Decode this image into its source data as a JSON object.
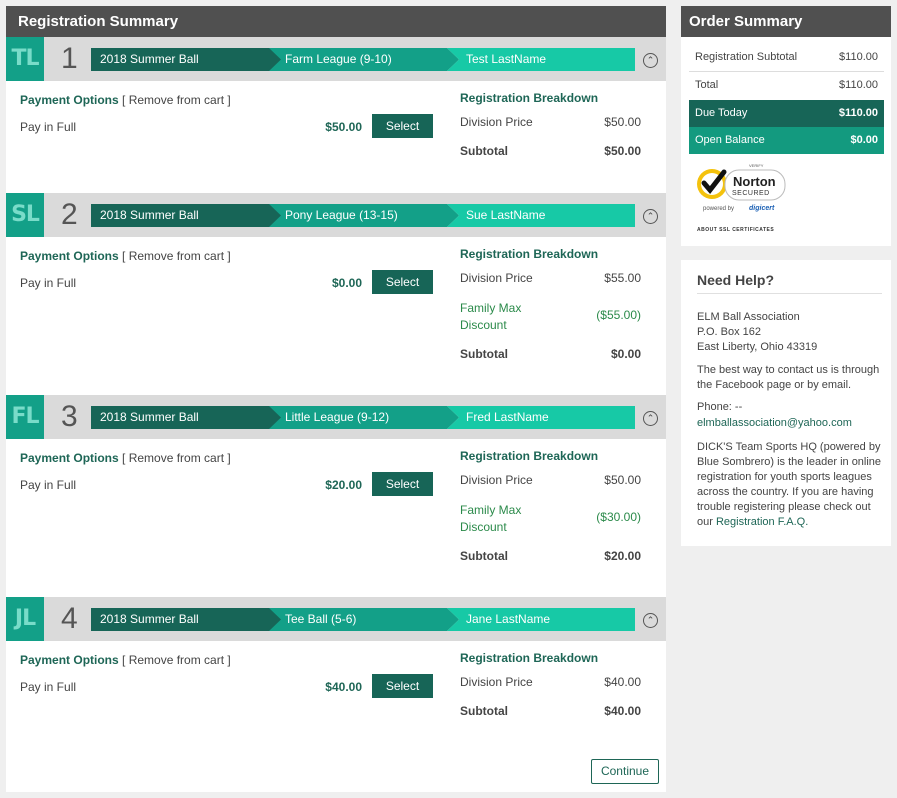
{
  "main": {
    "title": "Registration Summary",
    "continue_label": "Continue",
    "payment_options_label": "Payment Options",
    "remove_label": "[ Remove from cart ]",
    "pay_in_full_label": "Pay in Full",
    "select_label": "Select",
    "breakdown_title": "Registration Breakdown",
    "registrations": [
      {
        "initials": "TL",
        "number": "1",
        "season": "2018 Summer Ball",
        "league": "Farm League (9-10)",
        "player": "Test LastName",
        "price": "$50.00",
        "breakdown": [
          {
            "label": "Division Price",
            "value": "$50.00"
          }
        ],
        "subtotal_label": "Subtotal",
        "subtotal": "$50.00"
      },
      {
        "initials": "SL",
        "number": "2",
        "season": "2018 Summer Ball",
        "league": "Pony League (13-15)",
        "player": "Sue LastName",
        "price": "$0.00",
        "breakdown": [
          {
            "label": "Division Price",
            "value": "$55.00"
          },
          {
            "label": "Family Max Discount",
            "value": "($55.00)"
          }
        ],
        "subtotal_label": "Subtotal",
        "subtotal": "$0.00"
      },
      {
        "initials": "FL",
        "number": "3",
        "season": "2018 Summer Ball",
        "league": "Little League (9-12)",
        "player": "Fred LastName",
        "price": "$20.00",
        "breakdown": [
          {
            "label": "Division Price",
            "value": "$50.00"
          },
          {
            "label": "Family Max Discount",
            "value": "($30.00)"
          }
        ],
        "subtotal_label": "Subtotal",
        "subtotal": "$20.00"
      },
      {
        "initials": "JL",
        "number": "4",
        "season": "2018 Summer Ball",
        "league": "Tee Ball (5-6)",
        "player": "Jane LastName",
        "price": "$40.00",
        "breakdown": [
          {
            "label": "Division Price",
            "value": "$40.00"
          }
        ],
        "subtotal_label": "Subtotal",
        "subtotal": "$40.00"
      }
    ]
  },
  "order_summary": {
    "title": "Order Summary",
    "rows": [
      {
        "label": "Registration Subtotal",
        "value": "$110.00"
      },
      {
        "label": "Total",
        "value": "$110.00"
      },
      {
        "label": "Due Today",
        "value": "$110.00"
      },
      {
        "label": "Open Balance",
        "value": "$0.00"
      }
    ],
    "norton": {
      "verify": "VERIFY",
      "brand": "Norton",
      "secured": "SECURED",
      "powered_by": "powered by",
      "digicert": "digicert"
    },
    "about_ssl": "ABOUT SSL CERTIFICATES"
  },
  "help": {
    "title": "Need Help?",
    "org": "ELM Ball Association",
    "address1": "P.O. Box 162",
    "address2": "East Liberty, Ohio 43319",
    "contact_text": "The best way to contact us is through the Facebook page or by email.",
    "phone": "Phone: --",
    "email": "elmballassociation@yahoo.com",
    "about_text": "DICK'S Team Sports HQ (powered by Blue Sombrero) is the leader in online registration for youth sports leagues across the country. If you are having trouble registering please check out our",
    "faq_link": "Registration F.A.Q."
  },
  "colors": {
    "dark_green": "#176557",
    "mid_green": "#139a7f",
    "light_green": "#17c9a6",
    "header_gray": "#505050"
  }
}
